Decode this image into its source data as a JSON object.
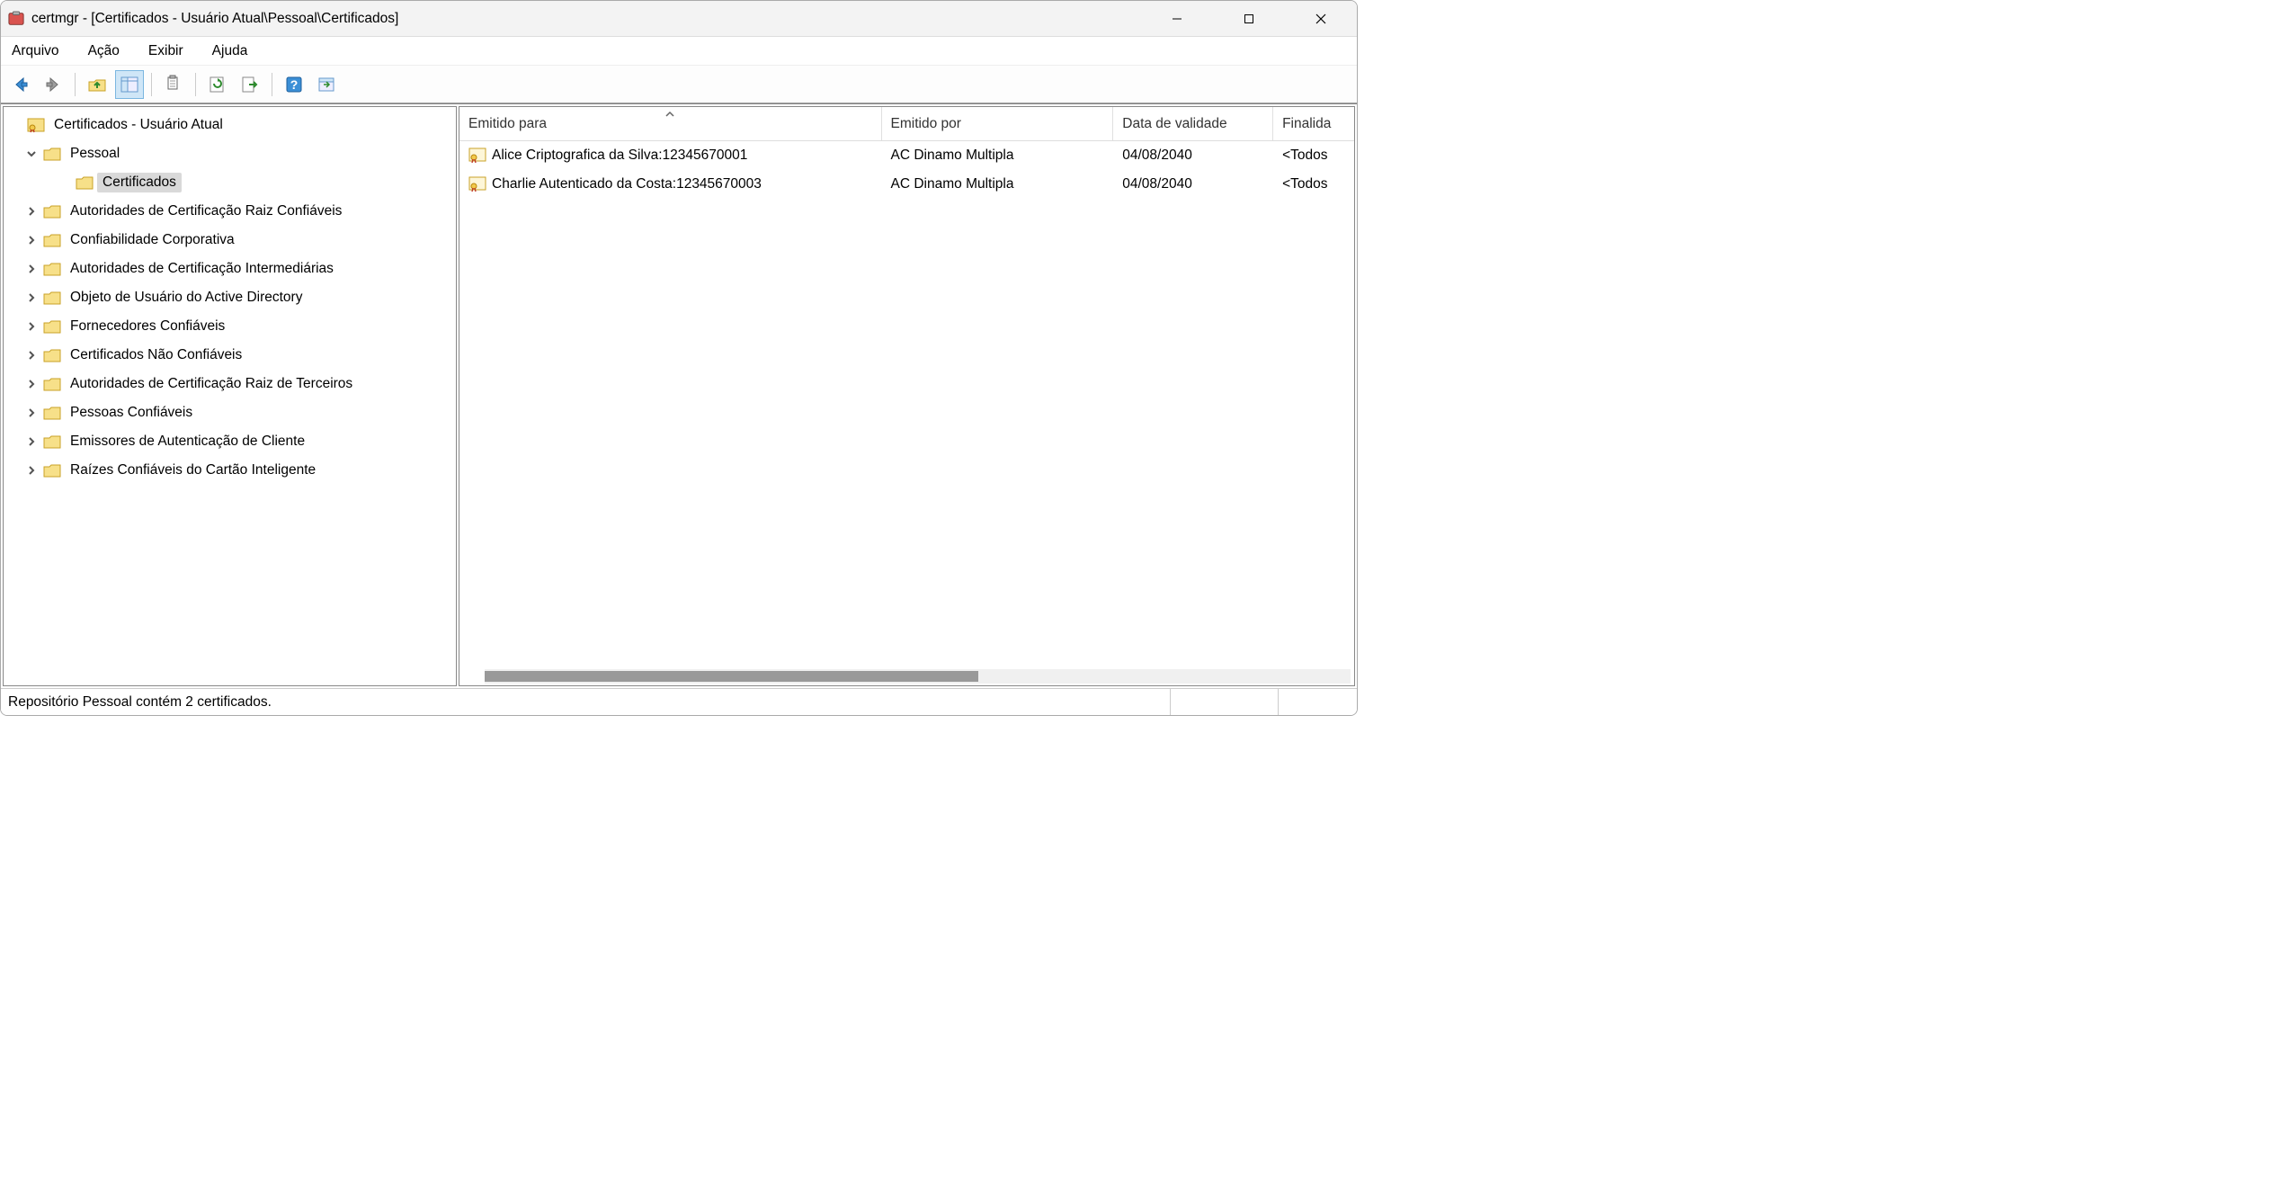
{
  "window": {
    "title": "certmgr - [Certificados - Usuário Atual\\Pessoal\\Certificados]"
  },
  "menu": {
    "file": "Arquivo",
    "action": "Ação",
    "view": "Exibir",
    "help": "Ajuda"
  },
  "tree": {
    "root": "Certificados - Usuário Atual",
    "items": [
      {
        "label": "Pessoal",
        "expanded": true,
        "children": [
          {
            "label": "Certificados",
            "selected": true
          }
        ]
      },
      {
        "label": "Autoridades de Certificação Raiz Confiáveis"
      },
      {
        "label": "Confiabilidade Corporativa"
      },
      {
        "label": "Autoridades de Certificação Intermediárias"
      },
      {
        "label": "Objeto de Usuário do Active Directory"
      },
      {
        "label": "Fornecedores Confiáveis"
      },
      {
        "label": "Certificados Não Confiáveis"
      },
      {
        "label": "Autoridades de Certificação Raiz de Terceiros"
      },
      {
        "label": "Pessoas Confiáveis"
      },
      {
        "label": "Emissores de Autenticação de Cliente"
      },
      {
        "label": "Raízes Confiáveis do Cartão Inteligente"
      }
    ]
  },
  "list": {
    "columns": {
      "issued_to": "Emitido para",
      "issued_by": "Emitido por",
      "expiry": "Data de validade",
      "purpose": "Finalida"
    },
    "rows": [
      {
        "issued_to": "Alice Criptografica da Silva:12345670001",
        "issued_by": "AC Dinamo Multipla",
        "expiry": "04/08/2040",
        "purpose": "<Todos"
      },
      {
        "issued_to": "Charlie Autenticado da Costa:12345670003",
        "issued_by": "AC Dinamo Multipla",
        "expiry": "04/08/2040",
        "purpose": "<Todos"
      }
    ]
  },
  "status": {
    "text": "Repositório Pessoal contém 2 certificados."
  }
}
